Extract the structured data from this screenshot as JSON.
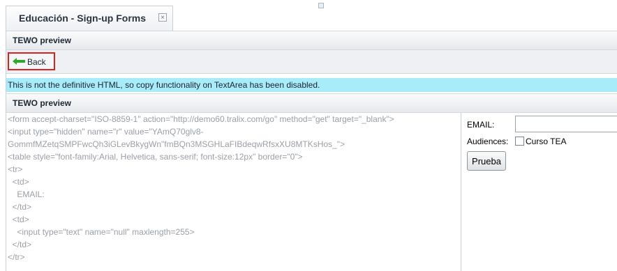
{
  "tab": {
    "title": "Educación - Sign-up Forms",
    "close_glyph": "×"
  },
  "panels": {
    "top_header": "TEWO preview",
    "second_header": "TEWO preview"
  },
  "toolbar": {
    "back_label": "Back",
    "back_icon": "back-arrow-icon"
  },
  "notice": {
    "text": "This is not the definitive HTML, so copy functionality on TextArea has been disabled."
  },
  "code_lines": [
    "<form accept-charset=\"ISO-8859-1\" action=\"http://demo60.tralix.com/go\" method=\"get\" target=\"_blank\">",
    "<input type=\"hidden\" name=\"r\" value=\"YAmQ70glv8-",
    "GommfMZetqSMPFwcQh3iGLevBkygWn\"fmBQn3MSGHLaFIBdeqwRfsxXU8MTKsHos_\">",
    "<table style=\"font-family:Arial, Helvetica, sans-serif; font-size:12px\" border=\"0\">",
    "<tr>",
    "  <td>",
    "    EMAIL:",
    "  </td>",
    "  <td>",
    "    <input type=\"text\" name=\"null\" maxlength=255>",
    "  </td>",
    "</tr>"
  ],
  "form_preview": {
    "email_label": "EMAIL:",
    "email_value": "",
    "audiences_label": "Audiences:",
    "audience_option": "Curso TEA",
    "audience_checked": false,
    "submit_label": "Prueba"
  },
  "colors": {
    "notice_bg": "#a8ecfa",
    "back_highlight": "#d6241c",
    "back_icon": "#2fa82f",
    "code_text": "#9aa0a7"
  }
}
